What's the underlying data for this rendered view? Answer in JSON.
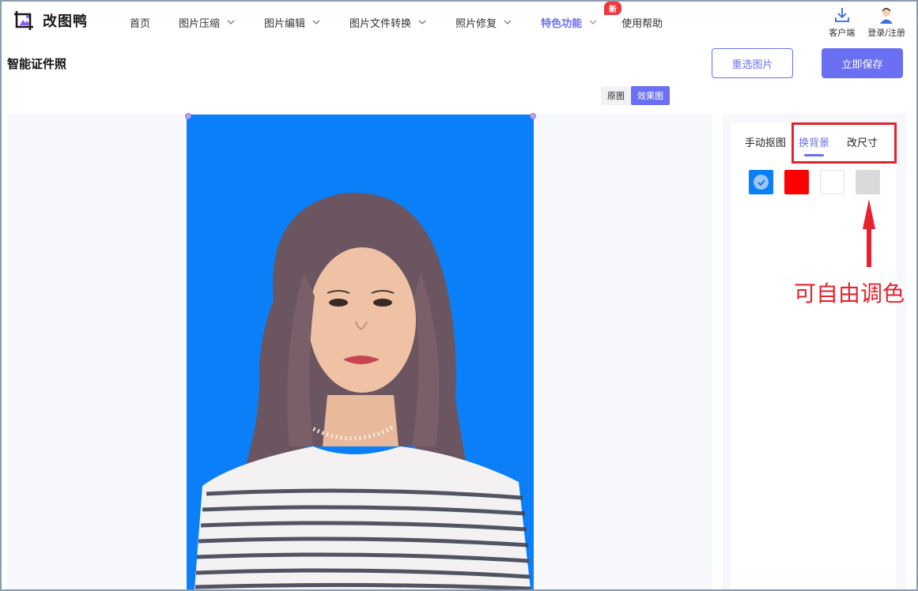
{
  "app": {
    "name": "改图鸭"
  },
  "nav": [
    {
      "label": "首页",
      "dropdown": false,
      "active": false
    },
    {
      "label": "图片压缩",
      "dropdown": true,
      "active": false
    },
    {
      "label": "图片编辑",
      "dropdown": true,
      "active": false
    },
    {
      "label": "图片文件转换",
      "dropdown": true,
      "active": false
    },
    {
      "label": "照片修复",
      "dropdown": true,
      "active": false
    },
    {
      "label": "特色功能",
      "dropdown": true,
      "active": true,
      "badge": "新"
    },
    {
      "label": "使用帮助",
      "dropdown": false,
      "active": false
    }
  ],
  "header_right": {
    "client_label": "客户端",
    "login_label": "登录/注册"
  },
  "page": {
    "title": "智能证件照",
    "reselect_label": "重选图片",
    "save_label": "立即保存",
    "view_toggle": {
      "original": "原图",
      "result": "效果图",
      "selected": "效果图"
    }
  },
  "panel": {
    "tabs": [
      {
        "label": "手动抠图",
        "active": false
      },
      {
        "label": "换背景",
        "active": true
      },
      {
        "label": "改尺寸",
        "active": false
      }
    ],
    "swatches": [
      {
        "name": "blue",
        "color": "#0a7ff7",
        "selected": true
      },
      {
        "name": "red",
        "color": "#ff0000",
        "selected": false
      },
      {
        "name": "white",
        "color": "#ffffff",
        "selected": false
      },
      {
        "name": "gray",
        "color": "#dadada",
        "selected": false
      }
    ]
  },
  "annotation": {
    "text": "可自由调色",
    "color": "#e6222e"
  },
  "colors": {
    "accent": "#6b70f2",
    "photo_background": "#0a7ff7"
  }
}
